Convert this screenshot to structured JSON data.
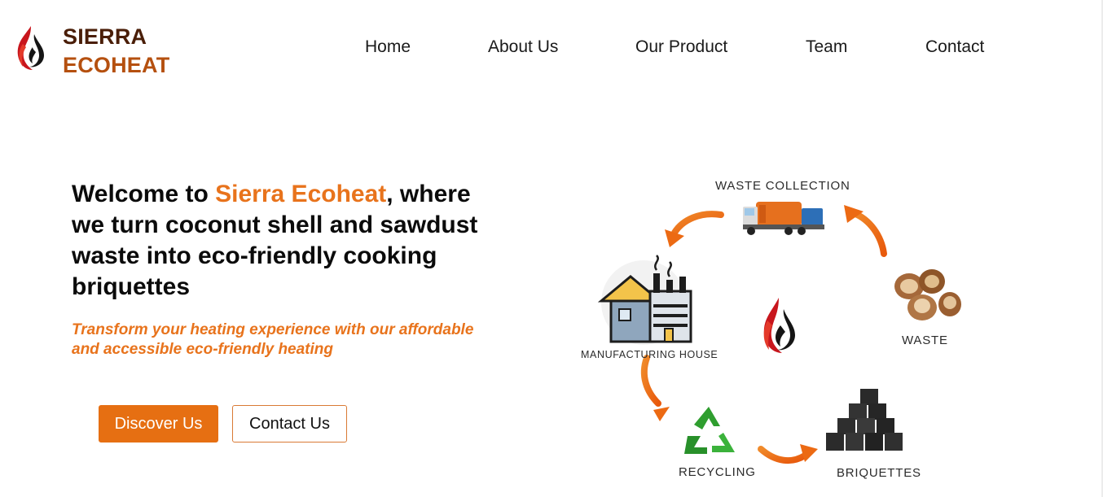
{
  "brand": {
    "line1": "SIERRA",
    "line2": "ECOHEAT"
  },
  "nav": {
    "items": [
      "Home",
      "About Us",
      "Our Product",
      "Team",
      "Contact"
    ]
  },
  "hero": {
    "title_prefix": "Welcome to ",
    "title_highlight": "Sierra Ecoheat",
    "title_suffix": ", where we turn coconut shell and sawdust waste into eco-friendly cooking briquettes",
    "subtitle": "Transform your heating experience with our affordable and accessible eco-friendly heating",
    "primary_button": "Discover Us",
    "secondary_button": "Contact Us"
  },
  "diagram": {
    "labels": {
      "waste_collection": "WASTE COLLECTION",
      "waste": "WASTE",
      "briquettes": "BRIQUETTES",
      "recycling": "RECYCLING",
      "manufacturing": "MANUFACTURING HOUSE"
    },
    "icons": [
      "garbage-truck-icon",
      "coconut-shells-icon",
      "briquettes-stack-icon",
      "recycle-icon",
      "factory-icon",
      "flame-logo-icon"
    ]
  },
  "colors": {
    "accent": "#e8731c",
    "button": "#e66f12",
    "brand_dark": "#4a1e08",
    "brand_orange": "#b5500f"
  }
}
